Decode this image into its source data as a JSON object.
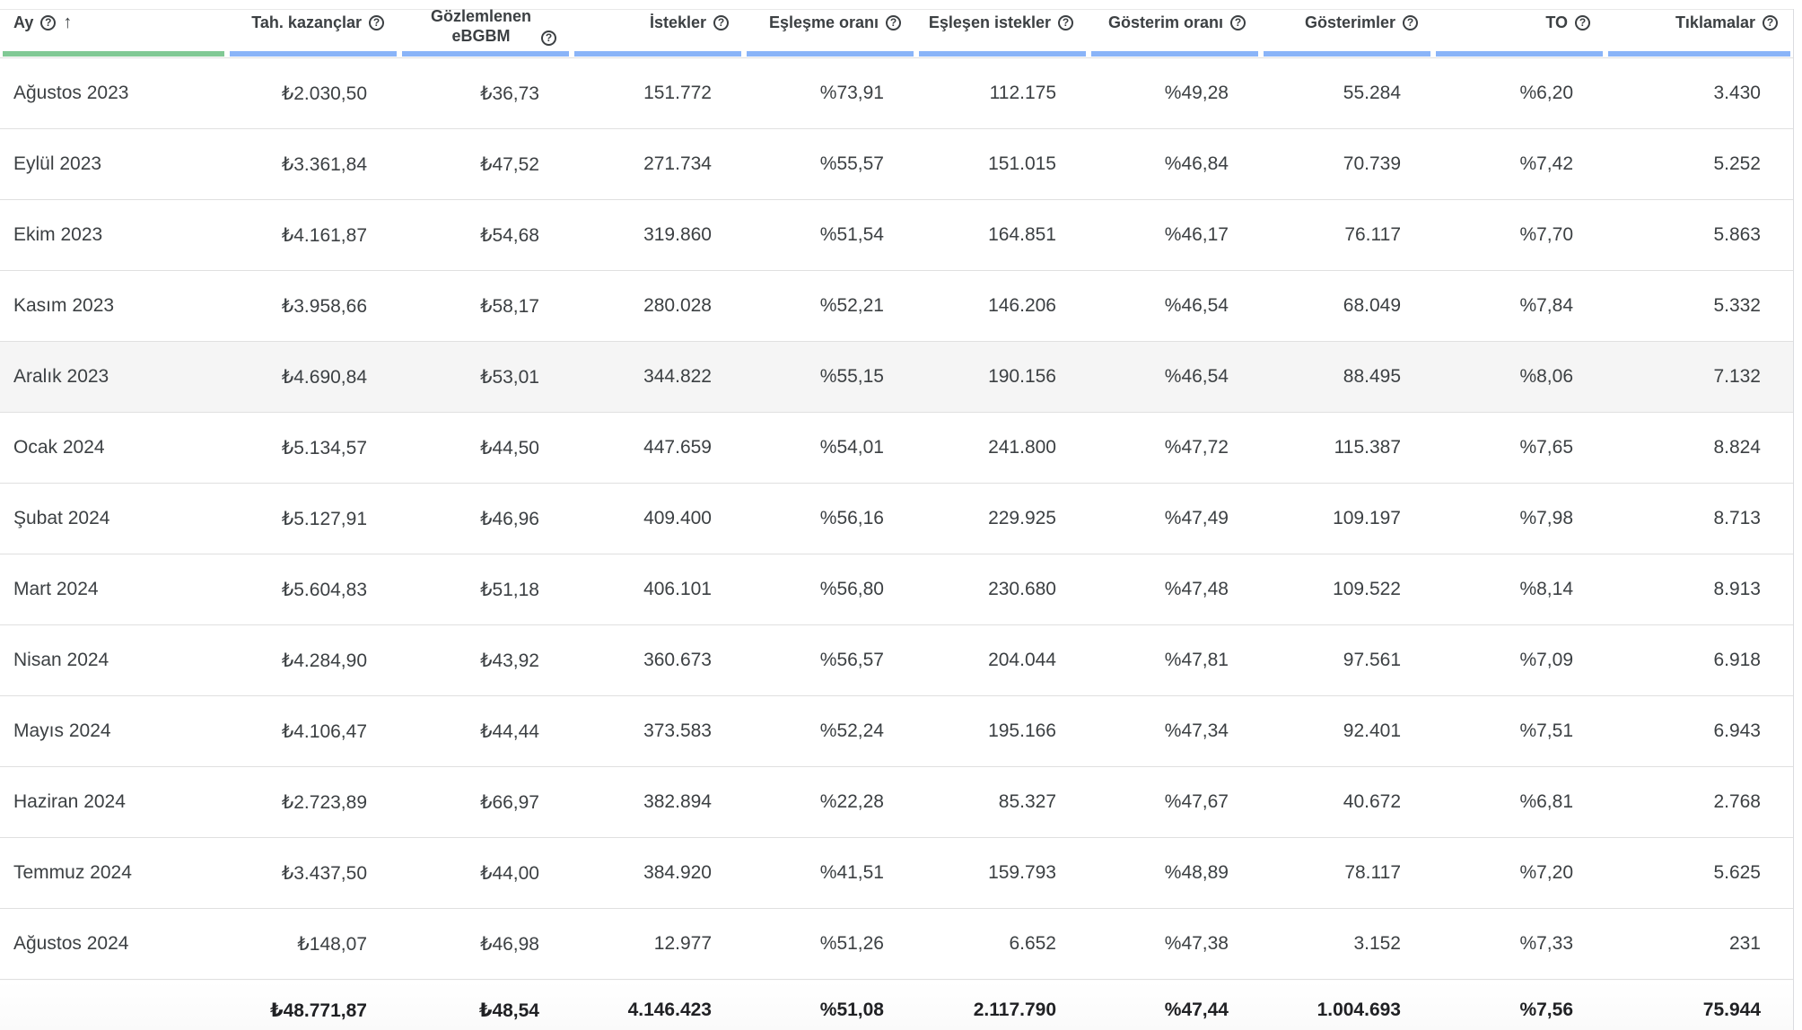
{
  "columns": [
    {
      "label": "Ay",
      "help": "?",
      "sort_icon": "arrow-up-icon",
      "underline": "#81c995"
    },
    {
      "label": "Tah. kazançlar",
      "help": "?",
      "underline": "#8ab4f8"
    },
    {
      "label": "Gözlemlenen eBGBM",
      "help": "?",
      "underline": "#8ab4f8"
    },
    {
      "label": "İstekler",
      "help": "?",
      "underline": "#8ab4f8"
    },
    {
      "label": "Eşleşme oranı",
      "help": "?",
      "underline": "#8ab4f8"
    },
    {
      "label": "Eşleşen istekler",
      "help": "?",
      "underline": "#8ab4f8"
    },
    {
      "label": "Gösterim oranı",
      "help": "?",
      "underline": "#8ab4f8"
    },
    {
      "label": "Gösterimler",
      "help": "?",
      "underline": "#8ab4f8"
    },
    {
      "label": "TO",
      "help": "?",
      "underline": "#8ab4f8"
    },
    {
      "label": "Tıklamalar",
      "help": "?",
      "underline": "#8ab4f8"
    }
  ],
  "rows": [
    [
      "Ağustos 2023",
      "₺2.030,50",
      "₺36,73",
      "151.772",
      "%73,91",
      "112.175",
      "%49,28",
      "55.284",
      "%6,20",
      "3.430"
    ],
    [
      "Eylül 2023",
      "₺3.361,84",
      "₺47,52",
      "271.734",
      "%55,57",
      "151.015",
      "%46,84",
      "70.739",
      "%7,42",
      "5.252"
    ],
    [
      "Ekim 2023",
      "₺4.161,87",
      "₺54,68",
      "319.860",
      "%51,54",
      "164.851",
      "%46,17",
      "76.117",
      "%7,70",
      "5.863"
    ],
    [
      "Kasım 2023",
      "₺3.958,66",
      "₺58,17",
      "280.028",
      "%52,21",
      "146.206",
      "%46,54",
      "68.049",
      "%7,84",
      "5.332"
    ],
    [
      "Aralık 2023",
      "₺4.690,84",
      "₺53,01",
      "344.822",
      "%55,15",
      "190.156",
      "%46,54",
      "88.495",
      "%8,06",
      "7.132"
    ],
    [
      "Ocak 2024",
      "₺5.134,57",
      "₺44,50",
      "447.659",
      "%54,01",
      "241.800",
      "%47,72",
      "115.387",
      "%7,65",
      "8.824"
    ],
    [
      "Şubat 2024",
      "₺5.127,91",
      "₺46,96",
      "409.400",
      "%56,16",
      "229.925",
      "%47,49",
      "109.197",
      "%7,98",
      "8.713"
    ],
    [
      "Mart 2024",
      "₺5.604,83",
      "₺51,18",
      "406.101",
      "%56,80",
      "230.680",
      "%47,48",
      "109.522",
      "%8,14",
      "8.913"
    ],
    [
      "Nisan 2024",
      "₺4.284,90",
      "₺43,92",
      "360.673",
      "%56,57",
      "204.044",
      "%47,81",
      "97.561",
      "%7,09",
      "6.918"
    ],
    [
      "Mayıs 2024",
      "₺4.106,47",
      "₺44,44",
      "373.583",
      "%52,24",
      "195.166",
      "%47,34",
      "92.401",
      "%7,51",
      "6.943"
    ],
    [
      "Haziran 2024",
      "₺2.723,89",
      "₺66,97",
      "382.894",
      "%22,28",
      "85.327",
      "%47,67",
      "40.672",
      "%6,81",
      "2.768"
    ],
    [
      "Temmuz 2024",
      "₺3.437,50",
      "₺44,00",
      "384.920",
      "%41,51",
      "159.793",
      "%48,89",
      "78.117",
      "%7,20",
      "5.625"
    ],
    [
      "Ağustos 2024",
      "₺148,07",
      "₺46,98",
      "12.977",
      "%51,26",
      "6.652",
      "%47,38",
      "3.152",
      "%7,33",
      "231"
    ]
  ],
  "totals": [
    "",
    "₺48.771,87",
    "₺48,54",
    "4.146.423",
    "%51,08",
    "2.117.790",
    "%47,44",
    "1.004.693",
    "%7,56",
    "75.944"
  ],
  "highlighted_row": 4,
  "colors": {
    "underline_sorted": "#81c995",
    "underline_default": "#8ab4f8",
    "row_hover": "#f5f5f5"
  }
}
